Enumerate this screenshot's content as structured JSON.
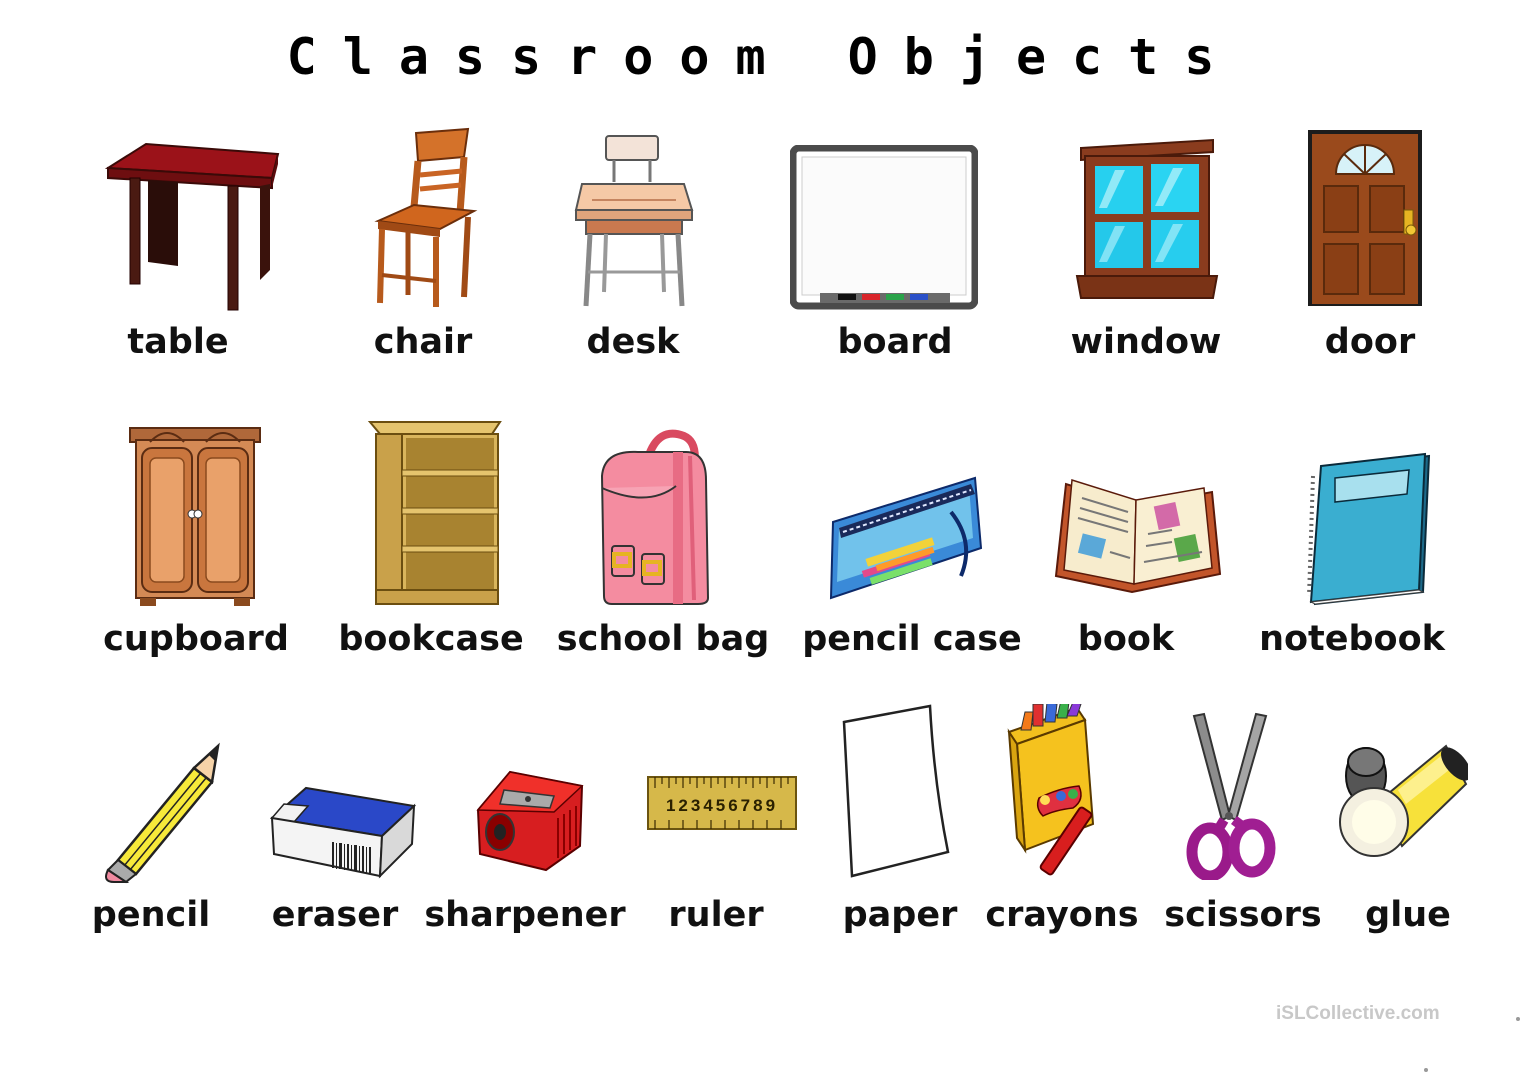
{
  "title": "Classroom Objects",
  "items": [
    {
      "label": "table",
      "icon": "table-icon"
    },
    {
      "label": "chair",
      "icon": "chair-icon"
    },
    {
      "label": "desk",
      "icon": "desk-icon"
    },
    {
      "label": "board",
      "icon": "board-icon"
    },
    {
      "label": "window",
      "icon": "window-icon"
    },
    {
      "label": "door",
      "icon": "door-icon"
    },
    {
      "label": "cupboard",
      "icon": "cupboard-icon"
    },
    {
      "label": "bookcase",
      "icon": "bookcase-icon"
    },
    {
      "label": "school bag",
      "icon": "school-bag-icon"
    },
    {
      "label": "pencil case",
      "icon": "pencil-case-icon"
    },
    {
      "label": "book",
      "icon": "book-icon"
    },
    {
      "label": "notebook",
      "icon": "notebook-icon"
    },
    {
      "label": "pencil",
      "icon": "pencil-icon"
    },
    {
      "label": "eraser",
      "icon": "eraser-icon"
    },
    {
      "label": "sharpener",
      "icon": "sharpener-icon"
    },
    {
      "label": "ruler",
      "icon": "ruler-icon",
      "ruler_digits": "123456789"
    },
    {
      "label": "paper",
      "icon": "paper-icon"
    },
    {
      "label": "crayons",
      "icon": "crayons-icon"
    },
    {
      "label": "scissors",
      "icon": "scissors-icon"
    },
    {
      "label": "glue",
      "icon": "glue-icon"
    }
  ],
  "watermark": "iSLCollective.com"
}
